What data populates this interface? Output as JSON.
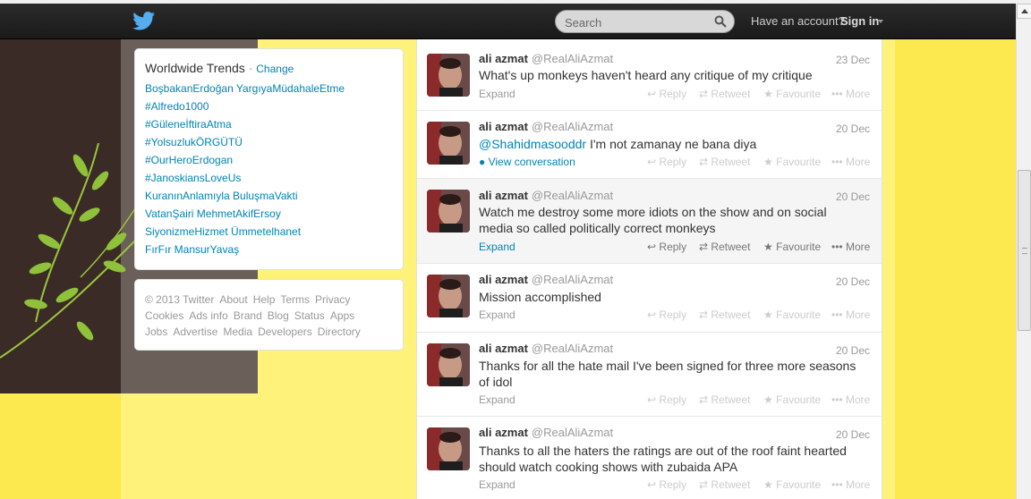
{
  "topbar": {
    "search_placeholder": "Search",
    "have_account": "Have an account?",
    "sign_in": "Sign in"
  },
  "trends": {
    "title": "Worldwide Trends",
    "separator": "·",
    "change": "Change",
    "items": [
      "BoşbakanErdoğan YargıyaMüdahaleEtme",
      "#Alfredo1000",
      "#GüleneİftiraAtma",
      "#YolsuzlukÖRGÜTÜ",
      "#OurHeroErdogan",
      "#JanoskiansLoveUs",
      "KuranınAnlamıyla BuluşmaVakti",
      "VatanŞairi MehmetAkifErsoy",
      "SiyonizmeHizmet Ümmetelhanet",
      "FırFır MansurYavaş"
    ]
  },
  "footer": {
    "links": [
      "© 2013 Twitter",
      "About",
      "Help",
      "Terms",
      "Privacy",
      "Cookies",
      "Ads info",
      "Brand",
      "Blog",
      "Status",
      "Apps",
      "Jobs",
      "Advertise",
      "Media",
      "Developers",
      "Directory"
    ]
  },
  "actions": {
    "reply": "Reply",
    "retweet": "Retweet",
    "favourite": "Favourite",
    "more": "More"
  },
  "tweets": [
    {
      "name": "ali azmat",
      "handle": "@RealAliAzmat",
      "date": "23 Dec",
      "text": "What's up monkeys haven't heard any critique of my critique",
      "footer_link": "Expand"
    },
    {
      "name": "ali azmat",
      "handle": "@RealAliAzmat",
      "date": "20 Dec",
      "mention": "@Shahidmasooddr",
      "text": "I'm not zamanay ne bana diya",
      "footer_link": "View conversation"
    },
    {
      "name": "ali azmat",
      "handle": "@RealAliAzmat",
      "date": "20 Dec",
      "text": "Watch me destroy some more idiots on the show and on social media so called politically correct monkeys",
      "footer_link": "Expand"
    },
    {
      "name": "ali azmat",
      "handle": "@RealAliAzmat",
      "date": "20 Dec",
      "text": "Mission accomplished",
      "footer_link": "Expand"
    },
    {
      "name": "ali azmat",
      "handle": "@RealAliAzmat",
      "date": "20 Dec",
      "text": "Thanks for all the hate mail I've been signed for three more seasons of idol",
      "footer_link": "Expand"
    },
    {
      "name": "ali azmat",
      "handle": "@RealAliAzmat",
      "date": "20 Dec",
      "text": "Thanks to all the haters the ratings are out of the roof faint hearted should watch cooking shows with zubaida APA",
      "footer_link": "Expand"
    }
  ]
}
